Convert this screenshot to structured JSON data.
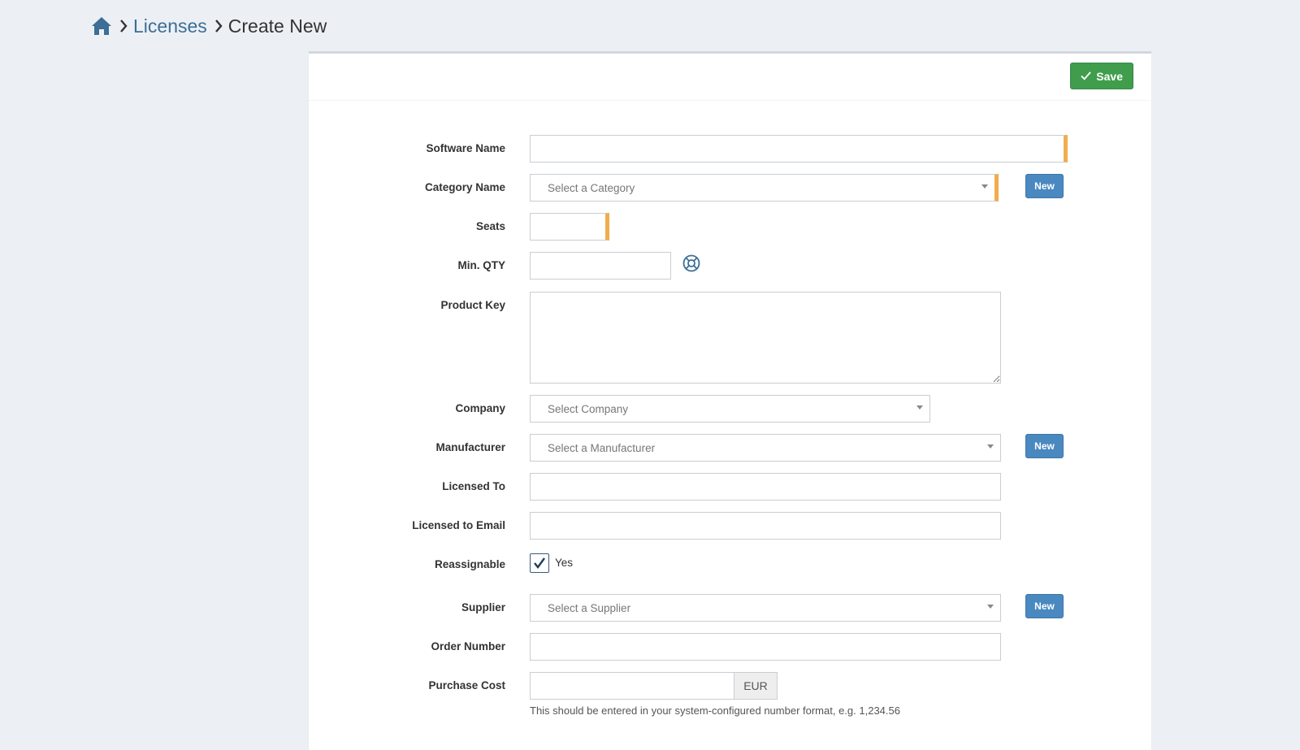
{
  "breadcrumb": {
    "home_icon": "home-icon",
    "licenses": "Licenses",
    "current": "Create New"
  },
  "header": {
    "save_label": "Save",
    "save_icon": "check-icon",
    "save_color": "#3f9d4c"
  },
  "colors": {
    "required_marker": "#f0ad4e",
    "new_button": "#4a88c0",
    "link": "#3c6e96",
    "background": "#ecf0f5"
  },
  "form": {
    "software_name": {
      "label": "Software Name",
      "value": ""
    },
    "category_name": {
      "label": "Category Name",
      "placeholder": "Select a Category",
      "new_label": "New"
    },
    "seats": {
      "label": "Seats",
      "value": ""
    },
    "min_qty": {
      "label": "Min. QTY",
      "value": "",
      "help_icon": "lifebuoy-icon"
    },
    "product_key": {
      "label": "Product Key",
      "value": ""
    },
    "company": {
      "label": "Company",
      "placeholder": "Select Company"
    },
    "manufacturer": {
      "label": "Manufacturer",
      "placeholder": "Select a Manufacturer",
      "new_label": "New"
    },
    "licensed_to": {
      "label": "Licensed To",
      "value": ""
    },
    "licensed_to_email": {
      "label": "Licensed to Email",
      "value": ""
    },
    "reassignable": {
      "label": "Reassignable",
      "checkbox_label": "Yes",
      "checked": true
    },
    "supplier": {
      "label": "Supplier",
      "placeholder": "Select a Supplier",
      "new_label": "New"
    },
    "order_number": {
      "label": "Order Number",
      "value": ""
    },
    "purchase_cost": {
      "label": "Purchase Cost",
      "value": "",
      "currency": "EUR",
      "help": "This should be entered in your system-configured number format, e.g. 1,234.56"
    }
  }
}
